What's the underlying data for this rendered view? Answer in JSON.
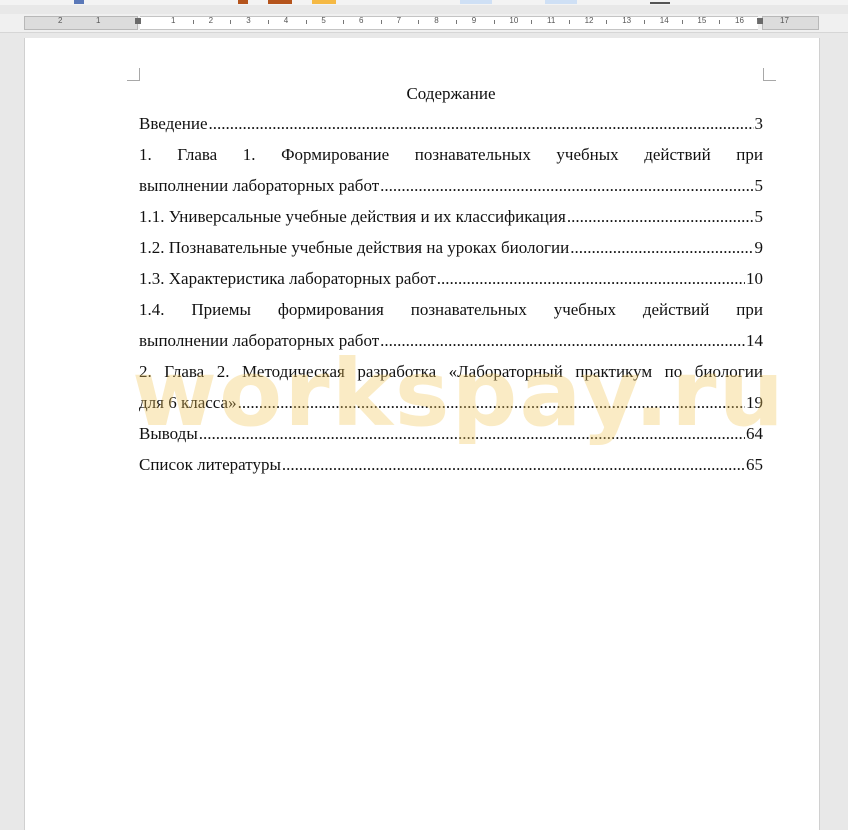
{
  "ruler": {
    "left_numbers": [
      "2",
      "1"
    ],
    "numbers": [
      "1",
      "2",
      "3",
      "4",
      "5",
      "6",
      "7",
      "8",
      "9",
      "10",
      "11",
      "12",
      "13",
      "14",
      "15",
      "16"
    ],
    "right_number": "17"
  },
  "document": {
    "title": "Содержание",
    "entries": [
      {
        "text": "Введение",
        "page": "3"
      },
      {
        "text_words": [
          "1.",
          "Глава",
          "1.",
          "Формирование",
          "познавательных",
          "учебных",
          "действий",
          "при"
        ],
        "cont": "выполнении лабораторных работ",
        "page": "5"
      },
      {
        "text": "1.1. Универсальные учебные действия и их классификация",
        "page": "5"
      },
      {
        "text": "1.2. Познавательные учебные действия на уроках биологии",
        "page": "9"
      },
      {
        "text": "1.3. Характеристика лабораторных работ",
        "page": "10"
      },
      {
        "text_words": [
          "1.4.",
          "Приемы",
          "формирования",
          "познавательных",
          "учебных",
          "действий",
          "при"
        ],
        "cont": "выполнении лабораторных работ",
        "page": "14"
      },
      {
        "text_words": [
          "2.",
          "Глава",
          "2.",
          "Методическая",
          "разработка",
          "«Лабораторный",
          "практикум",
          "по",
          "биологии"
        ],
        "cont": "для 6 класса»",
        "page": "19"
      },
      {
        "text": "Выводы",
        "page": "64"
      },
      {
        "text": "Список литературы",
        "page": "65"
      }
    ]
  },
  "watermark": "workspay.ru",
  "colors": {
    "watermark": "#f2c75b",
    "toolbar_accent_brown": "#b5541c",
    "toolbar_accent_orange": "#f5b944"
  }
}
